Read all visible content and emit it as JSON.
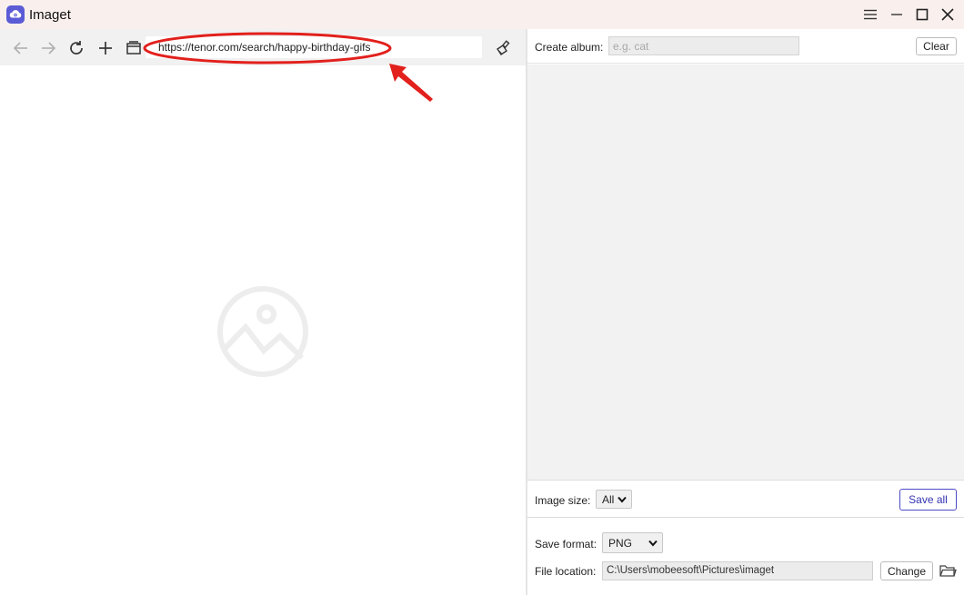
{
  "app": {
    "title": "Imaget"
  },
  "browser": {
    "url": "https://tenor.com/search/happy-birthday-gifs"
  },
  "album": {
    "label": "Create album:",
    "placeholder": "e.g. cat",
    "clear_label": "Clear"
  },
  "image_size": {
    "label": "Image size:",
    "selected": "All",
    "save_all_label": "Save all"
  },
  "save_format": {
    "label": "Save format:",
    "selected": "PNG"
  },
  "file_location": {
    "label": "File location:",
    "path": "C:\\Users\\mobeesoft\\Pictures\\imaget",
    "change_label": "Change"
  },
  "colors": {
    "accent": "#5b5bd6",
    "annotation": "#e2201c"
  }
}
